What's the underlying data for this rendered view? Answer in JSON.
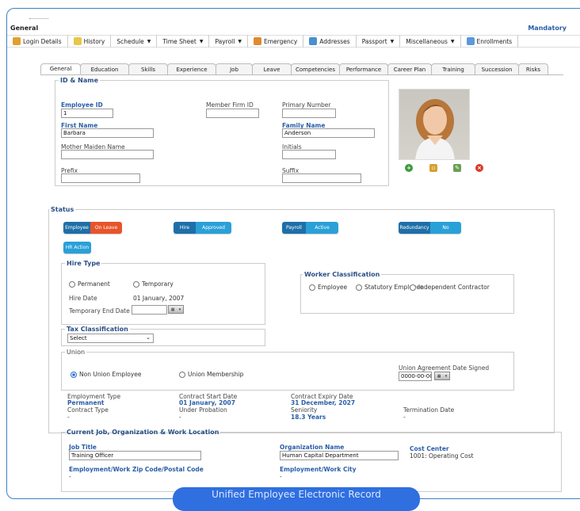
{
  "header": {
    "title": "General",
    "mandatory": "Mandatory"
  },
  "menu": [
    {
      "label": "Login Details",
      "icon": "user-icon",
      "color": "#e0a030",
      "dd": false
    },
    {
      "label": "History",
      "icon": "history-icon",
      "color": "#e6c84a",
      "dd": false
    },
    {
      "label": "Schedule",
      "icon": "",
      "color": "",
      "dd": true
    },
    {
      "label": "Time Sheet",
      "icon": "",
      "color": "",
      "dd": true
    },
    {
      "label": "Payroll",
      "icon": "",
      "color": "",
      "dd": true
    },
    {
      "label": "Emergency",
      "icon": "emergency-icon",
      "color": "#e08a30",
      "dd": false
    },
    {
      "label": "Addresses",
      "icon": "addresses-icon",
      "color": "#4a8fd0",
      "dd": false
    },
    {
      "label": "Passport",
      "icon": "",
      "color": "",
      "dd": true
    },
    {
      "label": "Miscellaneous",
      "icon": "",
      "color": "",
      "dd": true
    },
    {
      "label": "Enrollments",
      "icon": "enrollments-icon",
      "color": "#5a9ad8",
      "dd": false
    }
  ],
  "tabs": [
    "General",
    "Education",
    "Skills",
    "Experience",
    "Job",
    "Leave",
    "Competencies",
    "Performance",
    "Career Plan",
    "Training",
    "Succession",
    "Risks"
  ],
  "id_name": {
    "legend": "ID & Name",
    "employee_id_label": "Employee ID",
    "employee_id": "1",
    "member_firm_label": "Member Firm ID",
    "member_firm": "",
    "primary_number_label": "Primary Number",
    "primary_number": "",
    "first_name_label": "First Name",
    "first_name": "Barbara",
    "family_name_label": "Family Name",
    "family_name": "Anderson",
    "mother_maiden_label": "Mother Maiden Name",
    "mother_maiden": "",
    "initials_label": "Initials",
    "initials": "",
    "prefix_label": "Prefix",
    "prefix": "",
    "suffix_label": "Suffix",
    "suffix": ""
  },
  "status": {
    "legend": "Status",
    "employee": {
      "k": "Employee",
      "v": "On Leave"
    },
    "hire": {
      "k": "Hire",
      "v": "Approved"
    },
    "payroll": {
      "k": "Payroll",
      "v": "Active"
    },
    "redundancy": {
      "k": "Redundancy",
      "v": "No"
    },
    "hr_action": "HR Action"
  },
  "hire_type": {
    "legend": "Hire Type",
    "permanent": "Permanent",
    "temporary": "Temporary",
    "hire_date_label": "Hire Date",
    "hire_date": "01 January, 2007",
    "temp_end_label": "Temporary End Date",
    "temp_end": ""
  },
  "worker": {
    "legend": "Worker Classification",
    "opts": [
      "Employee",
      "Statutory Employee",
      "Independent Contractor"
    ]
  },
  "tax": {
    "legend": "Tax Classification",
    "selected": "Select"
  },
  "union": {
    "legend": "Union",
    "non_union": "Non Union Employee",
    "membership": "Union Membership",
    "agreement_label": "Union Agreement Date Signed",
    "agreement_date": "0000-00-00"
  },
  "employment": {
    "type_label": "Employment Type",
    "type": "Permanent",
    "contract_start_label": "Contract Start Date",
    "contract_start": "01 January, 2007",
    "contract_expiry_label": "Contract Expiry Date",
    "contract_expiry": "31 December, 2027",
    "contract_type_label": "Contract Type",
    "contract_type": "-",
    "probation_label": "Under Probation",
    "probation": "-",
    "seniority_label": "Seniority",
    "seniority": "18.3 Years",
    "termination_label": "Termination Date",
    "termination": "-"
  },
  "current_job": {
    "legend": "Current Job, Organization & Work Location",
    "job_title_label": "Job Title",
    "job_title": "Training Officer",
    "org_label": "Organization Name",
    "org": "Human Capital Department",
    "cost_label": "Cost Center",
    "cost": "1001: Operating Cost",
    "zip_label": "Employment/Work Zip Code/Postal Code",
    "zip": "-",
    "city_label": "Employment/Work City",
    "city": "-"
  },
  "footer_button": "Unified Employee Electronic Record"
}
